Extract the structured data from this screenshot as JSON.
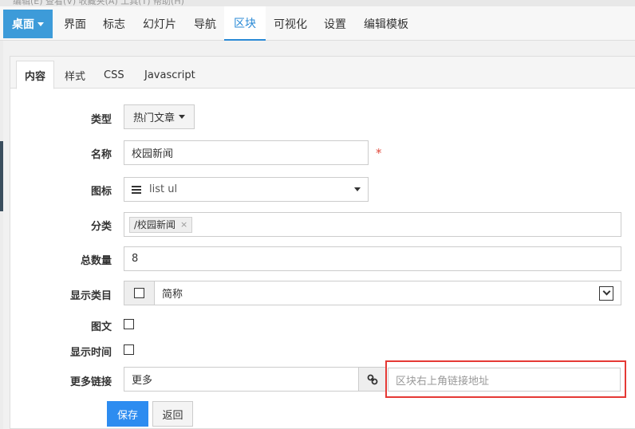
{
  "menu_strip": "编辑(E)   查看(V)   收藏夹(A)   工具(T)   帮助(H)",
  "navbar": {
    "brand": "桌面",
    "items": [
      "界面",
      "标志",
      "幻灯片",
      "导航",
      "区块",
      "可视化",
      "设置",
      "编辑模板"
    ],
    "active": "区块"
  },
  "tabs": [
    "内容",
    "样式",
    "CSS",
    "Javascript"
  ],
  "form": {
    "type": {
      "label": "类型",
      "value": "热门文章"
    },
    "name": {
      "label": "名称",
      "value": "校园新闻",
      "required_mark": "*"
    },
    "icon": {
      "label": "图标",
      "value": "list ul",
      "icon_name": "list-ul-icon"
    },
    "category": {
      "label": "分类",
      "tag": "/校园新闻",
      "tag_remove": "×"
    },
    "total": {
      "label": "总数量",
      "value": "8"
    },
    "show_category": {
      "label": "显示类目",
      "value": "简称"
    },
    "image_text": {
      "label": "图文"
    },
    "show_time": {
      "label": "显示时间"
    },
    "more_link": {
      "label": "更多链接",
      "value": "更多",
      "url_placeholder": "区块右上角链接地址"
    }
  },
  "buttons": {
    "save": "保存",
    "back": "返回"
  },
  "colors": {
    "brand": "#3d9bd9",
    "primary": "#2d8cf0",
    "active_nav": "#2a8ad6",
    "required": "#e04b3d",
    "highlight": "#e53935"
  }
}
